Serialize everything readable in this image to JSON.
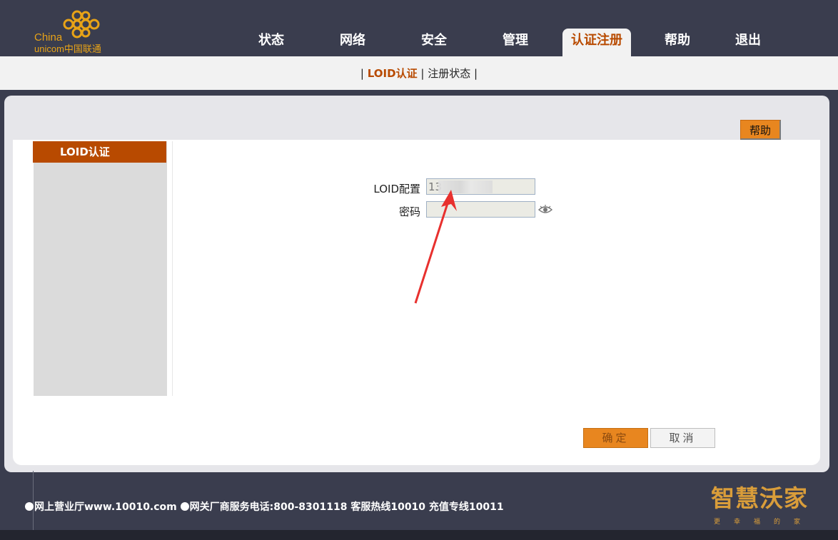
{
  "brand": {
    "logo_line1": "China",
    "logo_line2": "unicom中国联通",
    "logo_color": "#e8a317"
  },
  "nav": {
    "items": [
      {
        "label": "状态"
      },
      {
        "label": "网络"
      },
      {
        "label": "安全"
      },
      {
        "label": "管理"
      },
      {
        "label": "认证注册",
        "active": true
      },
      {
        "label": "帮助"
      },
      {
        "label": "退出"
      }
    ],
    "active_color": "#b84a00"
  },
  "subnav": {
    "sep_left": "|",
    "active": "LOID认证",
    "sep_mid": "|",
    "other": "注册状态",
    "sep_right": "|"
  },
  "help_button": "帮助",
  "sidebar": {
    "items": [
      {
        "label": "LOID认证",
        "active": true
      }
    ]
  },
  "form": {
    "loid_label": "LOID配置",
    "loid_value": "13",
    "password_label": "密码",
    "password_value": "",
    "show_password_icon": "eye-icon"
  },
  "buttons": {
    "ok": "确定",
    "cancel": "取消"
  },
  "footer": {
    "text1": "网上营业厅www.10010.com",
    "text2": "网关厂商服务电话:800-8301118 客服热线10010 充值专线10011",
    "brand": "智慧沃家",
    "slogan": "更幸福的家"
  },
  "colors": {
    "header_bg": "#3a3d4e",
    "accent_orange": "#e8861f",
    "accent_brown": "#b84a00"
  }
}
